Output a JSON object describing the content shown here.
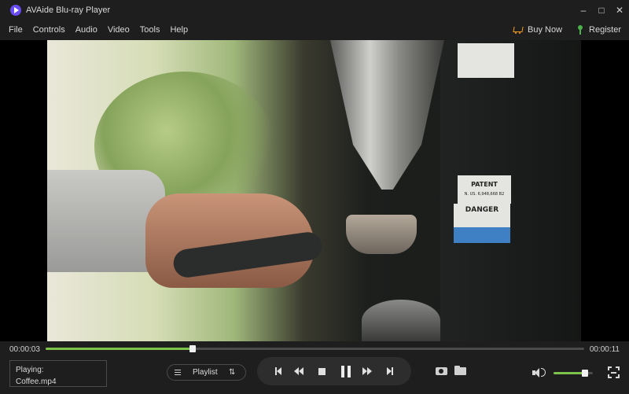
{
  "window": {
    "title": "AVAide Blu-ray Player",
    "minimize_glyph": "–",
    "maximize_glyph": "□",
    "close_glyph": "✕"
  },
  "menu": {
    "items": [
      "File",
      "Controls",
      "Audio",
      "Video",
      "Tools",
      "Help"
    ],
    "buy_now": "Buy Now",
    "register": "Register"
  },
  "video": {
    "label_patent": "PATENT",
    "label_patent_no": "N. US. 6,948,668 B2",
    "label_danger": "DANGER"
  },
  "playback": {
    "current_time": "00:00:03",
    "duration": "00:00:11",
    "progress_fraction": 0.273,
    "volume_fraction": 0.8
  },
  "now_playing": {
    "label": "Playing:",
    "file": "Coffee.mp4"
  },
  "playlist": {
    "label": "Playlist",
    "sort_glyph": "⇅"
  },
  "colors": {
    "accent": "#7dc34b",
    "buy_icon": "#f29b21",
    "register_icon": "#4bb14b",
    "logo": "#6a4cf3"
  }
}
